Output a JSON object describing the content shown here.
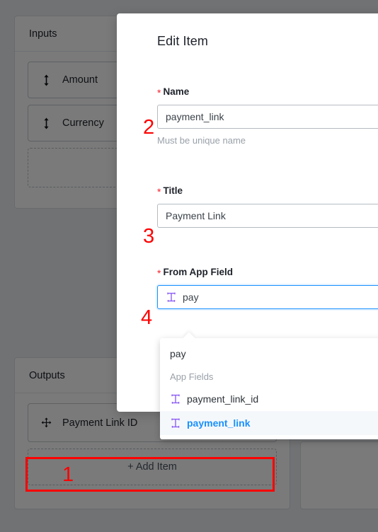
{
  "background": {
    "inputs_panel": {
      "title": "Inputs",
      "items": [
        {
          "label": "Amount",
          "handle_icon": "vertical-resize-arrows-icon"
        },
        {
          "label": "Currency",
          "handle_icon": "vertical-resize-arrows-icon"
        }
      ],
      "placeholder_slot": ""
    },
    "outputs_panel": {
      "title": "Outputs",
      "items": [
        {
          "label": "Payment Link ID",
          "handle_icon": "move-arrows-icon"
        }
      ],
      "add_item_label": "+ Add Item"
    }
  },
  "modal": {
    "title": "Edit Item",
    "fields": {
      "name": {
        "label": "Name",
        "required_marker": "*",
        "value": "payment_link",
        "hint": "Must be unique name"
      },
      "title": {
        "label": "Title",
        "required_marker": "*",
        "value": "Payment Link"
      },
      "from_app_field": {
        "label": "From App Field",
        "required_marker": "*",
        "value": "pay",
        "icon": "text-type-t-icon",
        "focused": true
      }
    }
  },
  "dropdown": {
    "free_text_option": "pay",
    "group_label": "App Fields",
    "options": [
      {
        "label": "payment_link_id",
        "icon": "text-type-t-icon",
        "selected": false
      },
      {
        "label": "payment_link",
        "icon": "text-type-t-icon",
        "selected": true
      }
    ]
  },
  "annotations": {
    "n1": "1",
    "n2": "2",
    "n3": "3",
    "n4": "4"
  },
  "colors": {
    "annotation_red": "#ff0000",
    "required_red": "#f5222d",
    "accent_blue": "#1890ff",
    "type_icon_purple": "#8b5cf6",
    "scrim": "rgba(0,0,0,0.52)"
  }
}
